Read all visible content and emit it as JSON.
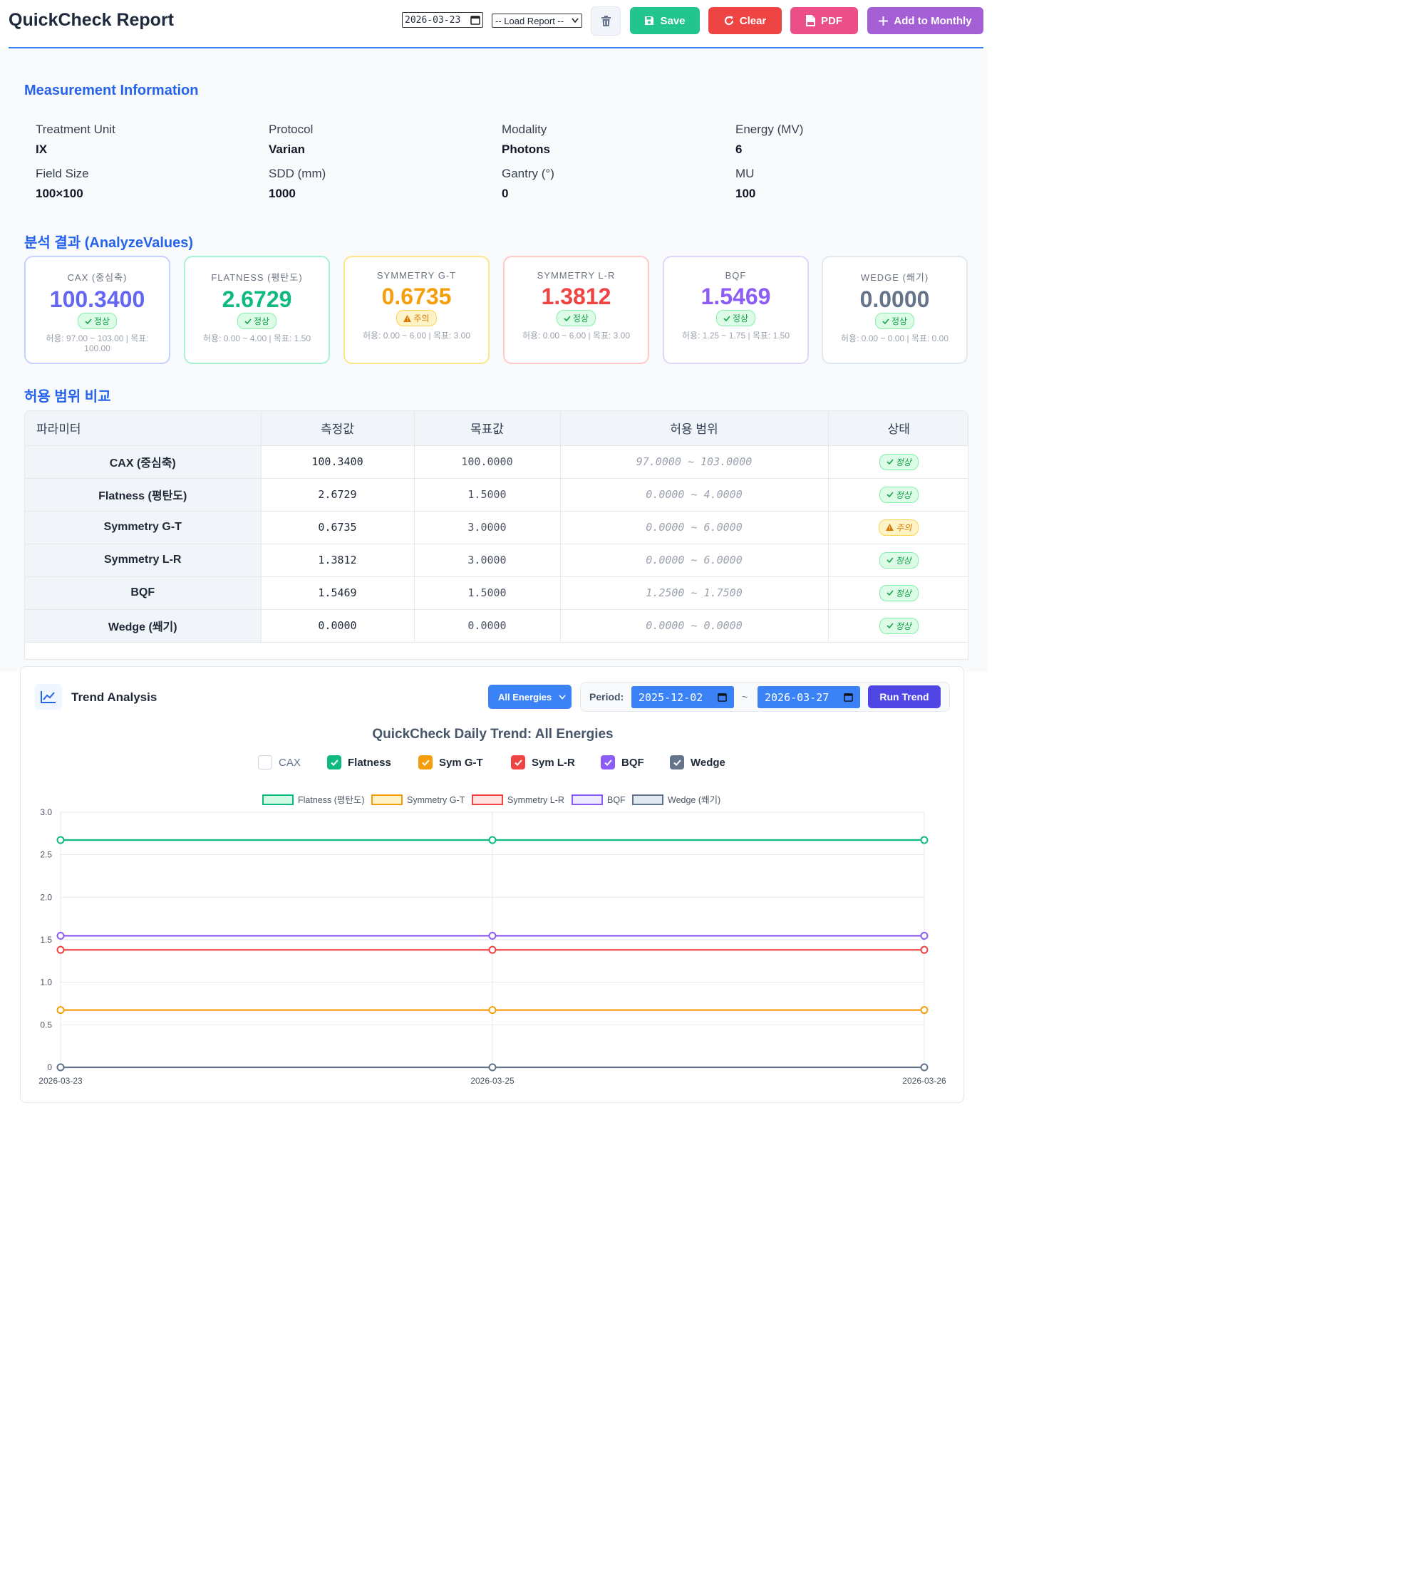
{
  "header": {
    "title": "QuickCheck Report",
    "date": "2026-03-23",
    "load_report": "-- Load Report --",
    "save": "Save",
    "clear": "Clear",
    "pdf": "PDF",
    "add_monthly": "Add to Monthly"
  },
  "measurement": {
    "title": "Measurement Information",
    "fields": [
      {
        "label": "Treatment Unit",
        "value": "IX"
      },
      {
        "label": "Protocol",
        "value": "Varian"
      },
      {
        "label": "Modality",
        "value": "Photons"
      },
      {
        "label": "Energy (MV)",
        "value": "6"
      },
      {
        "label": "Field Size",
        "value": "100×100"
      },
      {
        "label": "SDD (mm)",
        "value": "1000"
      },
      {
        "label": "Gantry (°)",
        "value": "0"
      },
      {
        "label": "MU",
        "value": "100"
      }
    ]
  },
  "analysis": {
    "title": "분석 결과 (AnalyzeValues)",
    "cards": [
      {
        "name": "CAX (중심축)",
        "value": "100.3400",
        "status": "정상",
        "range": "허용: 97.00 ~ 103.00 | 목표: 100.00",
        "color": "#6366f1",
        "border": "#c7d2fe"
      },
      {
        "name": "FLATNESS (평탄도)",
        "value": "2.6729",
        "status": "정상",
        "range": "허용: 0.00 ~ 4.00 | 목표: 1.50",
        "color": "#10b981",
        "border": "#a7f3d0"
      },
      {
        "name": "SYMMETRY G-T",
        "value": "0.6735",
        "status": "주의",
        "range": "허용: 0.00 ~ 6.00 | 목표: 3.00",
        "color": "#f59e0b",
        "border": "#fde68a"
      },
      {
        "name": "SYMMETRY L-R",
        "value": "1.3812",
        "status": "정상",
        "range": "허용: 0.00 ~ 6.00 | 목표: 3.00",
        "color": "#ef4444",
        "border": "#fecaca"
      },
      {
        "name": "BQF",
        "value": "1.5469",
        "status": "정상",
        "range": "허용: 1.25 ~ 1.75 | 목표: 1.50",
        "color": "#8b5cf6",
        "border": "#ddd6fe"
      },
      {
        "name": "WEDGE (쐐기)",
        "value": "0.0000",
        "status": "정상",
        "range": "허용: 0.00 ~ 0.00 | 목표: 0.00",
        "color": "#64748b",
        "border": "#e2e8f0"
      }
    ]
  },
  "tolerance": {
    "title": "허용 범위 비교",
    "headers": [
      "파라미터",
      "측정값",
      "목표값",
      "허용 범위",
      "상태"
    ],
    "rows": [
      {
        "param": "CAX (중심축)",
        "measured": "100.3400",
        "target": "100.0000",
        "range": "97.0000 ~ 103.0000",
        "status": "정상"
      },
      {
        "param": "Flatness (평탄도)",
        "measured": "2.6729",
        "target": "1.5000",
        "range": "0.0000 ~ 4.0000",
        "status": "정상"
      },
      {
        "param": "Symmetry G-T",
        "measured": "0.6735",
        "target": "3.0000",
        "range": "0.0000 ~ 6.0000",
        "status": "주의"
      },
      {
        "param": "Symmetry L-R",
        "measured": "1.3812",
        "target": "3.0000",
        "range": "0.0000 ~ 6.0000",
        "status": "정상"
      },
      {
        "param": "BQF",
        "measured": "1.5469",
        "target": "1.5000",
        "range": "1.2500 ~ 1.7500",
        "status": "정상"
      },
      {
        "param": "Wedge (쐐기)",
        "measured": "0.0000",
        "target": "0.0000",
        "range": "0.0000 ~ 0.0000",
        "status": "정상"
      }
    ]
  },
  "trend": {
    "title": "Trend Analysis",
    "energy_select": "All Energies",
    "period_label": "Period:",
    "period_start": "2025-12-02",
    "period_sep": "~",
    "period_end": "2026-03-27",
    "run_button": "Run Trend",
    "toggles": [
      {
        "label": "CAX",
        "checked": false,
        "color": "#94a3b8"
      },
      {
        "label": "Flatness",
        "checked": true,
        "color": "#10b981"
      },
      {
        "label": "Sym G-T",
        "checked": true,
        "color": "#f59e0b"
      },
      {
        "label": "Sym L-R",
        "checked": true,
        "color": "#ef4444"
      },
      {
        "label": "BQF",
        "checked": true,
        "color": "#8b5cf6"
      },
      {
        "label": "Wedge",
        "checked": true,
        "color": "#64748b"
      }
    ]
  },
  "chart_data": {
    "type": "line",
    "title": "QuickCheck Daily Trend: All Energies",
    "x": [
      "2026-03-23",
      "2026-03-25",
      "2026-03-26"
    ],
    "y_ticks": [
      "0",
      "0.5",
      "1.0",
      "1.5",
      "2.0",
      "2.5",
      "3.0"
    ],
    "ylim": [
      0,
      3.0
    ],
    "grid": true,
    "legend_position": "top",
    "series": [
      {
        "name": "Flatness (평탄도)",
        "values": [
          2.6729,
          2.6729,
          2.6729
        ],
        "color": "#10b981",
        "fill": "#d1fae5"
      },
      {
        "name": "Symmetry G-T",
        "values": [
          0.6735,
          0.6735,
          0.6735
        ],
        "color": "#f59e0b",
        "fill": "#fef3c7"
      },
      {
        "name": "Symmetry L-R",
        "values": [
          1.3812,
          1.3812,
          1.3812
        ],
        "color": "#ef4444",
        "fill": "#fee2e2"
      },
      {
        "name": "BQF",
        "values": [
          1.5469,
          1.5469,
          1.5469
        ],
        "color": "#8b5cf6",
        "fill": "#ede9fe"
      },
      {
        "name": "Wedge (쐐기)",
        "values": [
          0.0,
          0.0,
          0.0
        ],
        "color": "#64748b",
        "fill": "#e2e8f0"
      }
    ]
  }
}
